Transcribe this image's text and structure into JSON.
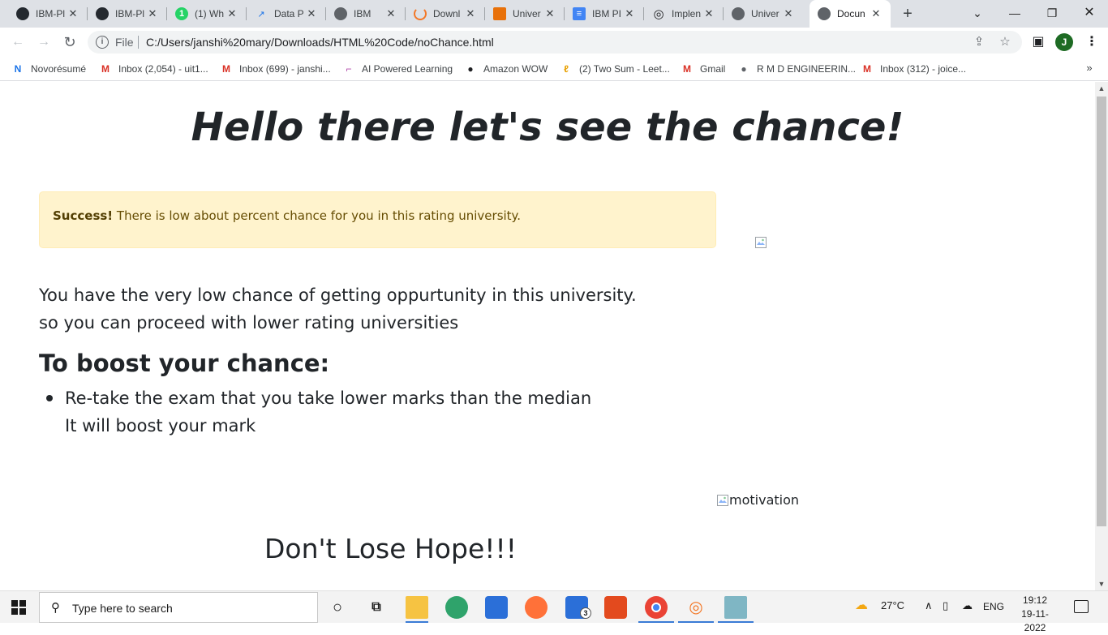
{
  "browser": {
    "tabs": [
      {
        "title": "IBM-Pl",
        "icon": "github-icon",
        "color": "#24292f",
        "glyph": "●"
      },
      {
        "title": "IBM-Pl",
        "icon": "github-icon",
        "color": "#24292f",
        "glyph": "●"
      },
      {
        "title": "(1) Wh",
        "icon": "whatsapp-icon",
        "color": "#25d366",
        "glyph": "1"
      },
      {
        "title": "Data P",
        "icon": "chart-line-icon",
        "color": "#ffffff",
        "glyph": "↗"
      },
      {
        "title": "IBM",
        "icon": "globe-icon",
        "color": "#5f6368",
        "glyph": "●"
      },
      {
        "title": "Downl",
        "icon": "jupyter-icon",
        "color": "#f37726",
        "glyph": "◡"
      },
      {
        "title": "Univer",
        "icon": "book-icon",
        "color": "#e8710a",
        "glyph": "▮"
      },
      {
        "title": "IBM PI",
        "icon": "docs-icon",
        "color": "#4285f4",
        "glyph": "≡"
      },
      {
        "title": "Implen",
        "icon": "openai-icon",
        "color": "#202124",
        "glyph": "◎"
      },
      {
        "title": "Univer",
        "icon": "globe-icon",
        "color": "#5f6368",
        "glyph": "●"
      },
      {
        "title": "Docun",
        "icon": "globe-icon",
        "color": "#5f6368",
        "glyph": "●",
        "active": true
      }
    ],
    "new_tab_label": "+",
    "window_controls": {
      "dropdown": "⌄",
      "minimize": "—",
      "restore": "❐",
      "close": "✕"
    },
    "address": {
      "scheme_label": "File",
      "url": "C:/Users/janshi%20mary/Downloads/HTML%20Code/noChance.html"
    },
    "profile_initial": "J",
    "bookmarks": [
      {
        "label": "Novorésumé",
        "icon": "novoresume-icon",
        "color": "#1a73e8",
        "glyph": "N"
      },
      {
        "label": "Inbox (2,054) - uit1...",
        "icon": "gmail-icon",
        "color": "#d93025",
        "glyph": "M"
      },
      {
        "label": "Inbox (699) - janshi...",
        "icon": "gmail-icon",
        "color": "#d93025",
        "glyph": "M"
      },
      {
        "label": "AI Powered Learning",
        "icon": "ai-learning-icon",
        "color": "#b044a8",
        "glyph": "⌐"
      },
      {
        "label": "Amazon WOW",
        "icon": "amazon-icon",
        "color": "#202124",
        "glyph": "●"
      },
      {
        "label": "(2) Two Sum - Leet...",
        "icon": "leetcode-icon",
        "color": "#e8a000",
        "glyph": "ℓ"
      },
      {
        "label": "Gmail",
        "icon": "gmail-icon",
        "color": "#d93025",
        "glyph": "M"
      },
      {
        "label": "R M D ENGINEERIN...",
        "icon": "globe-icon",
        "color": "#5f6368",
        "glyph": "●"
      },
      {
        "label": "Inbox (312) - joice...",
        "icon": "gmail-icon",
        "color": "#d93025",
        "glyph": "M"
      }
    ],
    "bookmarks_overflow": "»"
  },
  "page": {
    "heading": "Hello there let's see the chance!",
    "alert": {
      "strong": "Success!",
      "text": " There is low about percent chance for you in this rating university."
    },
    "intro_lines": [
      "You have the very low chance of getting oppurtunity in this university.",
      "so you can proceed with lower rating universities"
    ],
    "boost_heading": "To boost your chance:",
    "tips": [
      {
        "line1": "Re-take the exam that you take lower marks than the median",
        "line2": "It will boost your mark"
      }
    ],
    "motivation_alt": "motivation",
    "closing": "Don't Lose Hope!!!"
  },
  "taskbar": {
    "search_placeholder": "Type here to search",
    "apps": [
      {
        "name": "cortana",
        "icon": "cortana-icon"
      },
      {
        "name": "task-view",
        "icon": "task-view-icon"
      },
      {
        "name": "file-explorer",
        "icon": "folder-icon"
      },
      {
        "name": "edge",
        "icon": "edge-icon"
      },
      {
        "name": "store",
        "icon": "store-icon"
      },
      {
        "name": "firefox",
        "icon": "firefox-icon"
      },
      {
        "name": "mail",
        "icon": "mail-icon",
        "badge": "3"
      },
      {
        "name": "office",
        "icon": "office-icon"
      },
      {
        "name": "chrome",
        "icon": "chrome-icon"
      },
      {
        "name": "jupyter",
        "icon": "jupyter-icon"
      },
      {
        "name": "notebook",
        "icon": "notebook-icon"
      }
    ],
    "weather": "27°C",
    "language": "ENG",
    "time": "19:12",
    "date": "19-11-2022"
  }
}
